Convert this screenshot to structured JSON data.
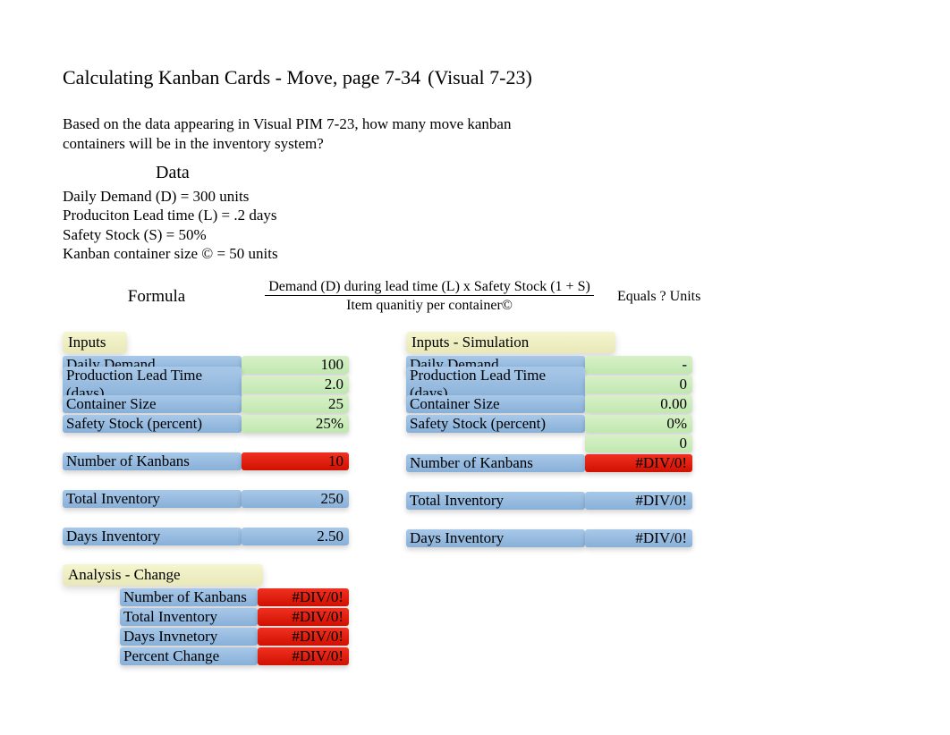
{
  "title": {
    "main": "Calculating Kanban Cards - Move, page 7-34",
    "visual": "(Visual 7-23)"
  },
  "question": "Based on the data appearing in Visual PIM 7-23, how many move kanban containers will be in the inventory system?",
  "data_header": "Data",
  "data_lines": {
    "l1": "Daily Demand (D) = 300 units",
    "l2": "Produciton Lead time (L) = .2 days",
    "l3": "Safety Stock (S) = 50%",
    "l4": "Kanban container size © = 50 units"
  },
  "formula": {
    "label": "Formula",
    "numerator": "Demand (D) during lead time (L) x Safety Stock (1 + S)",
    "denominator": "Item quanitiy per container©",
    "equals": "Equals ? Units"
  },
  "inputs": {
    "header": "Inputs",
    "daily_demand_lbl": "Daily Demand",
    "daily_demand": "100",
    "plt_lbl": "Production Lead Time (days)",
    "plt": "2.0",
    "cs_lbl": "Container Size",
    "cs": "25",
    "ss_lbl": "Safety Stock (percent)",
    "ss": "25%",
    "nk_lbl": "Number of Kanbans",
    "nk": "10",
    "ti_lbl": "Total Inventory",
    "ti": "250",
    "di_lbl": "Days Inventory",
    "di": "2.50"
  },
  "sim": {
    "header": "Inputs - Simulation",
    "daily_demand_lbl": "Daily Demand",
    "daily_demand": "-",
    "plt_lbl": "Production Lead Time (days)",
    "plt": "0",
    "cs_lbl": "Container Size",
    "cs": "0.00",
    "ss_lbl": "Safety Stock (percent)",
    "ss": "0%",
    "extra": "0",
    "nk_lbl": "Number of Kanbans",
    "nk": "#DIV/0!",
    "ti_lbl": "Total Inventory",
    "ti": "#DIV/0!",
    "di_lbl": "Days Inventory",
    "di": "#DIV/0!"
  },
  "analysis": {
    "header": "Analysis - Change",
    "nk_lbl": "Number of Kanbans",
    "nk": "#DIV/0!",
    "ti_lbl": "Total Inventory",
    "ti": "#DIV/0!",
    "di_lbl": "Days Invnetory",
    "di": "#DIV/0!",
    "pc_lbl": "Percent Change",
    "pc": "#DIV/0!"
  }
}
